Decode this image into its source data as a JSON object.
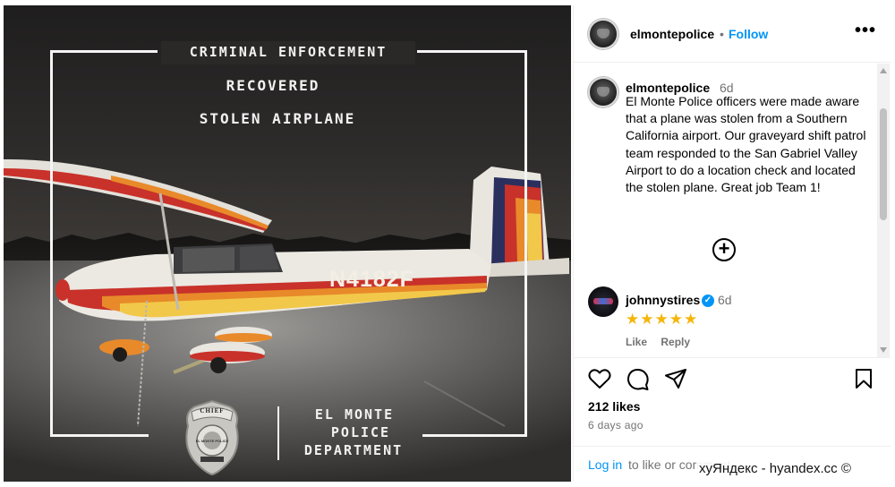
{
  "image": {
    "header_line": "CRIMINAL ENFORCEMENT",
    "line2": "RECOVERED",
    "line3": "STOLEN AIRPLANE",
    "tail_number": "N4182F",
    "badge_top": "CHIEF",
    "badge_center": "EL MONTE POLICE",
    "department_line1": "EL MONTE",
    "department_line2": "POLICE",
    "department_line3": "DEPARTMENT"
  },
  "post": {
    "author": "elmontepolice",
    "separator": "•",
    "follow_label": "Follow",
    "more_label": "•••",
    "caption": {
      "author": "elmontepolice",
      "age": "6d",
      "text": "El Monte Police officers were made aware that a plane was stolen from a Southern California airport.  Our graveyard shift patrol team responded to the San Gabriel Valley Airport to do a location check and located the stolen plane.  Great job Team 1!"
    },
    "load_more_label": "+",
    "reply": {
      "author": "johnnystires",
      "verified_mark": "✓",
      "age": "6d",
      "text": "★★★★★",
      "like_label": "Like",
      "reply_label": "Reply"
    },
    "likes": "212 likes",
    "posted": "6 days ago",
    "login_link": "Log in",
    "login_rest": "to like or comment."
  },
  "watermark": "хуЯндекс - hyandex.cc ©",
  "colors": {
    "link_blue": "#0095f6",
    "muted": "#737373",
    "star": "#f5b50a",
    "plane_stripe_red": "#c8322a",
    "plane_stripe_orange": "#e88a2a",
    "plane_stripe_yellow": "#f2c84a",
    "plane_tail_navy": "#2b2f5e"
  }
}
